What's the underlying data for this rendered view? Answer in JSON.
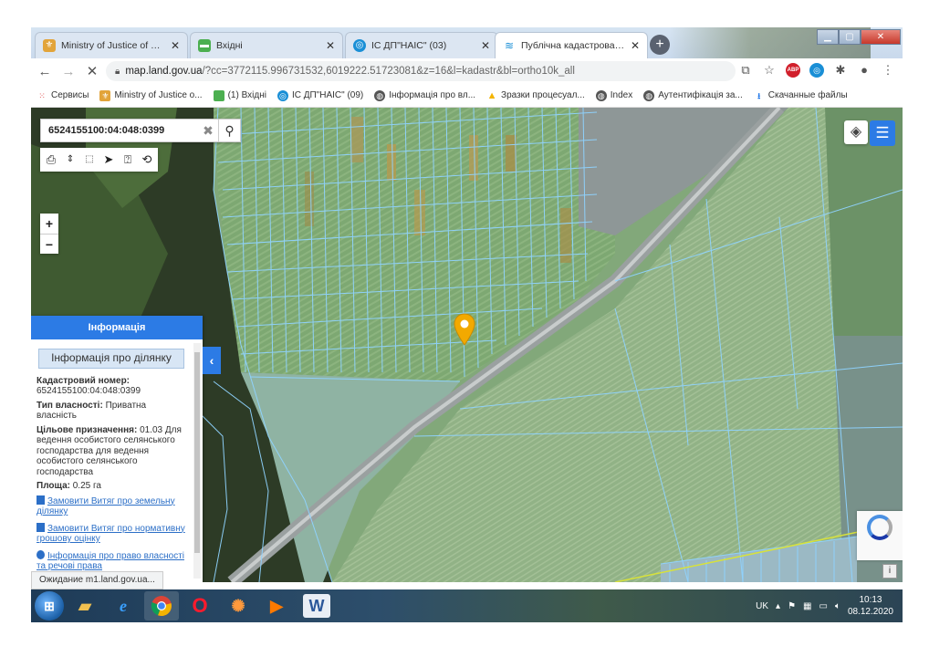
{
  "browser": {
    "tabs": [
      {
        "title": "Ministry of Justice of Ukraine :: В",
        "icon": "ministry-emblem-icon",
        "active": false
      },
      {
        "title": "Вхідні",
        "icon": "mail-inbox-icon",
        "active": false
      },
      {
        "title": "ІС ДП\"НАІС\" (03)",
        "icon": "nais-icon",
        "active": false
      },
      {
        "title": "Публічна кадастрова карта Укр",
        "icon": "cadastre-map-icon",
        "active": true
      }
    ],
    "url": {
      "host": "map.land.gov.ua",
      "rest": "/?cc=3772115.996731532,6019222.51723081&z=16&l=kadastr&bl=ortho10k_all"
    },
    "bookmarks": [
      {
        "label": "Сервисы",
        "icon": "apps-grid-icon"
      },
      {
        "label": "Ministry of Justice o...",
        "icon": "ministry-emblem-icon"
      },
      {
        "label": "(1) Вхідні",
        "icon": "mail-inbox-icon"
      },
      {
        "label": "ІС ДП\"НАІС\" (09)",
        "icon": "nais-icon"
      },
      {
        "label": "Інформація про вл...",
        "icon": "globe-icon"
      },
      {
        "label": "Зразки процесуал...",
        "icon": "google-drive-icon"
      },
      {
        "label": "Index",
        "icon": "globe-icon"
      },
      {
        "label": "Аутентифікація за...",
        "icon": "globe-icon"
      },
      {
        "label": "Скачанные файлы",
        "icon": "download-icon"
      }
    ],
    "status": "Ожидание m1.land.gov.ua..."
  },
  "map": {
    "search_value": "6524155100:04:048:0399",
    "tool_icons": [
      "print-icon",
      "measure-line-icon",
      "measure-area-icon",
      "pointer-icon",
      "identify-icon",
      "route-icon"
    ]
  },
  "info_panel": {
    "header": "Інформація",
    "subtitle": "Інформація про ділянку",
    "cadastral_label": "Кадастровий номер:",
    "cadastral_value": "6524155100:04:048:0399",
    "ownership_label": "Тип власності:",
    "ownership_value": "Приватна власність",
    "purpose_label": "Цільове призначення:",
    "purpose_value": "01.03 Для ведення особистого селянського господарства для ведення особистого селянського господарства",
    "area_label": "Площа:",
    "area_value": "0.25 га",
    "links": [
      "Замовити Витяг про земельну ділянку",
      "Замовити Витяг про нормативну грошову оцінку",
      "Інформація про право власності та речові права"
    ]
  },
  "taskbar": {
    "lang": "UK",
    "time": "10:13",
    "date": "08.12.2020"
  },
  "colors": {
    "accent": "#2c7be5",
    "marker": "#f2a900",
    "parcel_line": "#8fd3ff"
  }
}
